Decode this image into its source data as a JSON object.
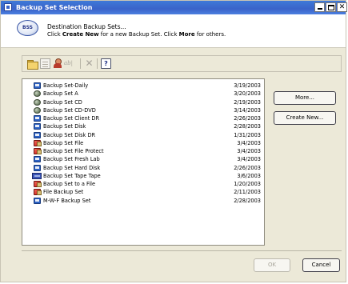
{
  "window": {
    "title": "Backup Set Selection"
  },
  "header": {
    "icon_text": "BSS",
    "line1": "Destination Backup Sets...",
    "line2_pre": "Click ",
    "line2_bold1": "Create New",
    "line2_mid": " for a new Backup Set. Click ",
    "line2_bold2": "More",
    "line2_post": " for others."
  },
  "toolbar": {
    "items": [
      "new-folder",
      "properties",
      "user",
      "rename",
      "delete",
      "help"
    ],
    "rename_label": "ab|",
    "delete_label": "✕",
    "help_label": "?"
  },
  "backup_sets": [
    {
      "name": "Backup Set-Daily",
      "date": "3/19/2003",
      "icon": "disk"
    },
    {
      "name": "Backup Set A",
      "date": "3/20/2003",
      "icon": "network"
    },
    {
      "name": "Backup Set CD",
      "date": "2/19/2003",
      "icon": "network"
    },
    {
      "name": "Backup Set CD-DVD",
      "date": "3/14/2003",
      "icon": "network"
    },
    {
      "name": "Backup Set Client DR",
      "date": "2/26/2003",
      "icon": "disk"
    },
    {
      "name": "Backup Set Disk",
      "date": "2/28/2003",
      "icon": "disk"
    },
    {
      "name": "Backup Set Disk DR",
      "date": "1/31/2003",
      "icon": "disk"
    },
    {
      "name": "Backup Set File",
      "date": "3/4/2003",
      "icon": "file"
    },
    {
      "name": "Backup Set File Protect",
      "date": "3/4/2003",
      "icon": "file"
    },
    {
      "name": "Backup Set Fresh Lab",
      "date": "3/4/2003",
      "icon": "disk"
    },
    {
      "name": "Backup Set Hard Disk",
      "date": "2/26/2003",
      "icon": "disk"
    },
    {
      "name": "Backup Set Tape Tape",
      "date": "3/6/2003",
      "icon": "tape"
    },
    {
      "name": "Backup Set to a File",
      "date": "1/20/2003",
      "icon": "file"
    },
    {
      "name": "File Backup Set",
      "date": "2/11/2003",
      "icon": "file"
    },
    {
      "name": "M-W-F Backup Set",
      "date": "2/28/2003",
      "icon": "disk"
    }
  ],
  "buttons": {
    "more": "More...",
    "create_new": "Create New...",
    "ok": "OK",
    "cancel": "Cancel"
  },
  "colors": {
    "titlebar": "#3a63c9",
    "dialog_bg": "#ece9d8",
    "disk_icon": "#2e63c5",
    "file_icon": "#d8352c"
  }
}
